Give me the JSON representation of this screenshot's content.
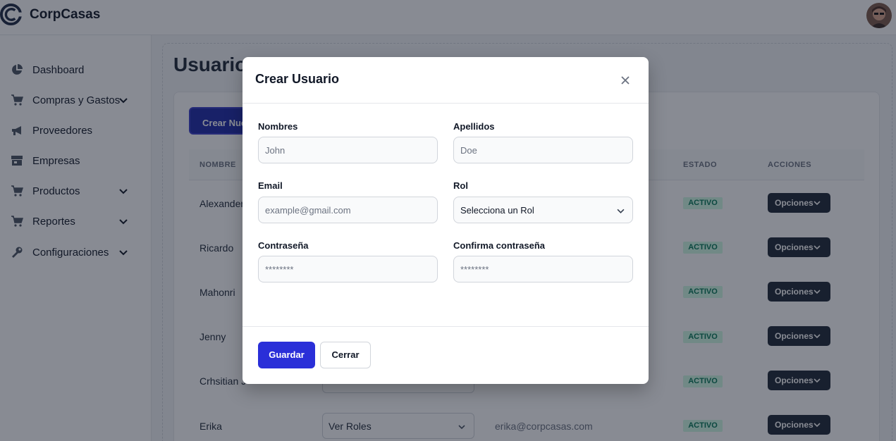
{
  "brand": {
    "name": "CorpCasas",
    "logo_icon": "corpcasas-logo-icon"
  },
  "sidebar": {
    "items": [
      {
        "label": "Dashboard",
        "icon": "pie-chart-icon",
        "has_children": false
      },
      {
        "label": "Compras y Gastos",
        "icon": "cart-icon",
        "has_children": true
      },
      {
        "label": "Proveedores",
        "icon": "megaphone-icon",
        "has_children": false
      },
      {
        "label": "Empresas",
        "icon": "store-icon",
        "has_children": false
      },
      {
        "label": "Productos",
        "icon": "cart-icon",
        "has_children": true
      },
      {
        "label": "Reportes",
        "icon": "cart-icon",
        "has_children": true
      },
      {
        "label": "Configuraciones",
        "icon": "wrench-icon",
        "has_children": true
      }
    ]
  },
  "page": {
    "title": "Usuarios",
    "create_button": "Crear Nuevo Usuario"
  },
  "table": {
    "headers": {
      "name": "NOMBRE",
      "status": "ESTADO",
      "actions": "ACCIONES"
    },
    "rows": [
      {
        "name": "Alexander",
        "status": "ACTIVO",
        "actions": "Opciones"
      },
      {
        "name": "Ricardo",
        "status": "ACTIVO",
        "actions": "Opciones"
      },
      {
        "name": "Mahonri",
        "status": "ACTIVO",
        "actions": "Opciones"
      },
      {
        "name": "Jenny",
        "status": "ACTIVO",
        "actions": "Opciones"
      },
      {
        "name": "Crhsitian J",
        "status": "ACTIVO",
        "actions": "Opciones"
      },
      {
        "name": "Erika",
        "roles": "Ver Roles",
        "email": "erika@corpcasas.com",
        "status": "ACTIVO",
        "actions": "Opciones"
      }
    ]
  },
  "modal": {
    "title": "Crear Usuario",
    "fields": {
      "first_name": {
        "label": "Nombres",
        "placeholder": "John",
        "value": ""
      },
      "last_name": {
        "label": "Apellidos",
        "placeholder": "Doe",
        "value": ""
      },
      "email": {
        "label": "Email",
        "placeholder": "example@gmail.com",
        "value": ""
      },
      "role": {
        "label": "Rol",
        "selected": "Selecciona un Rol"
      },
      "password": {
        "label": "Contraseña",
        "placeholder": "********",
        "value": ""
      },
      "confirm_password": {
        "label": "Confirma contraseña",
        "placeholder": "********",
        "value": ""
      }
    },
    "save_label": "Guardar",
    "close_label": "Cerrar"
  },
  "colors": {
    "primary": "#2a2fd8",
    "create_button": "#1e2aa8",
    "dark_button": "#1f2937",
    "status_active_bg": "#d1fae5",
    "status_active_text": "#047857",
    "overlay": "rgba(17,24,39,0.5)"
  }
}
